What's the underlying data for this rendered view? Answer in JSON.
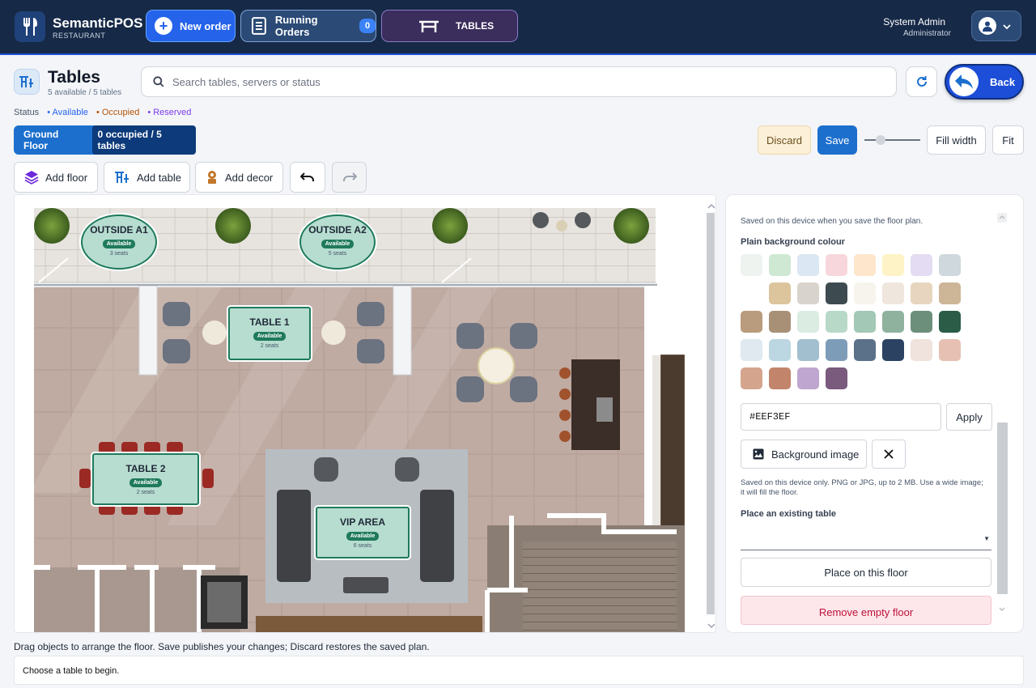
{
  "topbar": {
    "brand_name": "SemanticPOS",
    "brand_sub": "RESTAURANT",
    "new_order_label": "New order",
    "running_orders_label": "Running Orders",
    "running_orders_count": "0",
    "tables_label": "TABLES",
    "user_name": "System Admin",
    "user_role": "Administrator"
  },
  "page": {
    "title": "Tables",
    "subtitle": "5 available / 5 tables",
    "search_placeholder": "Search tables, servers or status",
    "back_label": "Back"
  },
  "legend": {
    "label": "Status",
    "available": "• Available",
    "occupied": "• Occupied",
    "reserved": "• Reserved"
  },
  "floor_tab": {
    "name": "Ground Floor",
    "count": "0 occupied / 5 tables"
  },
  "actions": {
    "discard": "Discard",
    "save": "Save",
    "zoom_level": 0.25,
    "fill_width": "Fill width",
    "fit": "Fit"
  },
  "toolbar": {
    "add_floor": "Add floor",
    "add_table": "Add table",
    "add_decor": "Add decor"
  },
  "tables": [
    {
      "name": "OUTSIDE A1",
      "status": "Available",
      "seats": "3 seats"
    },
    {
      "name": "OUTSIDE A2",
      "status": "Available",
      "seats": "5 seats"
    },
    {
      "name": "TABLE 1",
      "status": "Available",
      "seats": "2 seats"
    },
    {
      "name": "TABLE 2",
      "status": "Available",
      "seats": "2 seats"
    },
    {
      "name": "VIP AREA",
      "status": "Available",
      "seats": "6 seats"
    }
  ],
  "panel": {
    "note_saved": "Saved on this device when you save the floor plan.",
    "bg_colour_heading": "Plain background colour",
    "swatches": [
      "#eef3ef",
      "#cfe8d3",
      "#dbe7f3",
      "#f7d7dc",
      "#fde6cc",
      "#fdf3c6",
      "#e4dcf2",
      "#cfd8dc",
      "#ffffff",
      "#dcc49c",
      "#d8d3cc",
      "#3d4a4f",
      "#f7f4ee",
      "#efe6dd",
      "#e7d5c0",
      "#cdb597",
      "#b99b7d",
      "#a89077",
      "#dbece2",
      "#b8d9c8",
      "#a3c8b5",
      "#8fb29f",
      "#6c8f7c",
      "#2b5c48",
      "#dfe9ef",
      "#bcd7e2",
      "#a2bfd0",
      "#7d9cb8",
      "#5b7089",
      "#2c4263",
      "#f0e2dc",
      "#e6c1b3",
      "#d4a48d",
      "#c2846b",
      "#bfa6d0",
      "#7a5a7d"
    ],
    "hex_value": "#EEF3EF",
    "apply_label": "Apply",
    "bg_image_label": "Background image",
    "note_image": "Saved on this device only. PNG or JPG, up to 2 MB. Use a wide image; it will fill the floor.",
    "place_heading": "Place an existing table",
    "place_button": "Place on this floor",
    "remove_button": "Remove empty floor"
  },
  "footer": {
    "hint": "Drag objects to arrange the floor. Save publishes your changes; Discard restores the saved plan.",
    "status": "Choose a table to begin."
  }
}
